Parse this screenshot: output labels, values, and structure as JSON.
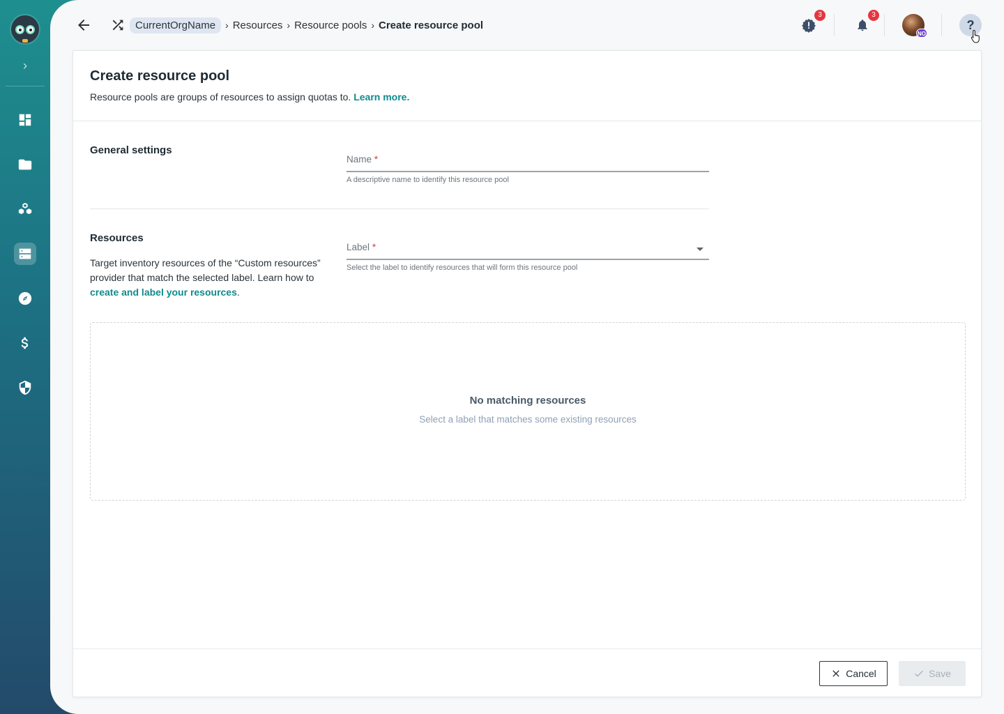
{
  "sidebar": {
    "items": [
      {
        "icon": "dashboard-icon"
      },
      {
        "icon": "folder-icon"
      },
      {
        "icon": "boxes-icon"
      },
      {
        "icon": "server-icon",
        "active": true
      },
      {
        "icon": "compass-icon"
      },
      {
        "icon": "dollar-icon"
      },
      {
        "icon": "shield-icon"
      }
    ]
  },
  "breadcrumb": {
    "org": "CurrentOrgName",
    "items": [
      "Resources",
      "Resource pools"
    ],
    "current": "Create resource pool"
  },
  "topbar": {
    "alerts_count": "3",
    "notifications_count": "3",
    "avatar_initials": "NO",
    "help_label": "?"
  },
  "header": {
    "title": "Create resource pool",
    "description": "Resource pools are groups of resources to assign quotas to. ",
    "learn_more": "Learn more."
  },
  "general": {
    "title": "General settings",
    "name_label": "Name",
    "required_mark": "*",
    "name_help": "A descriptive name to identify this resource pool"
  },
  "resources": {
    "title": "Resources",
    "text": "Target inventory resources of the “Custom resources” provider that match the selected label. Learn how to ",
    "link": "create and label your resources",
    "text_end": ".",
    "label_label": "Label",
    "label_help": "Select the label to identify resources that will form this resource pool"
  },
  "empty_state": {
    "title": "No matching resources",
    "subtitle": "Select a label that matches some existing resources"
  },
  "footer": {
    "cancel_label": "Cancel",
    "save_label": "Save"
  },
  "colors": {
    "accent": "#0f8b8d",
    "badge": "#e5363f",
    "sidebar_top": "#1e8f8f",
    "sidebar_bottom": "#234a6a"
  }
}
